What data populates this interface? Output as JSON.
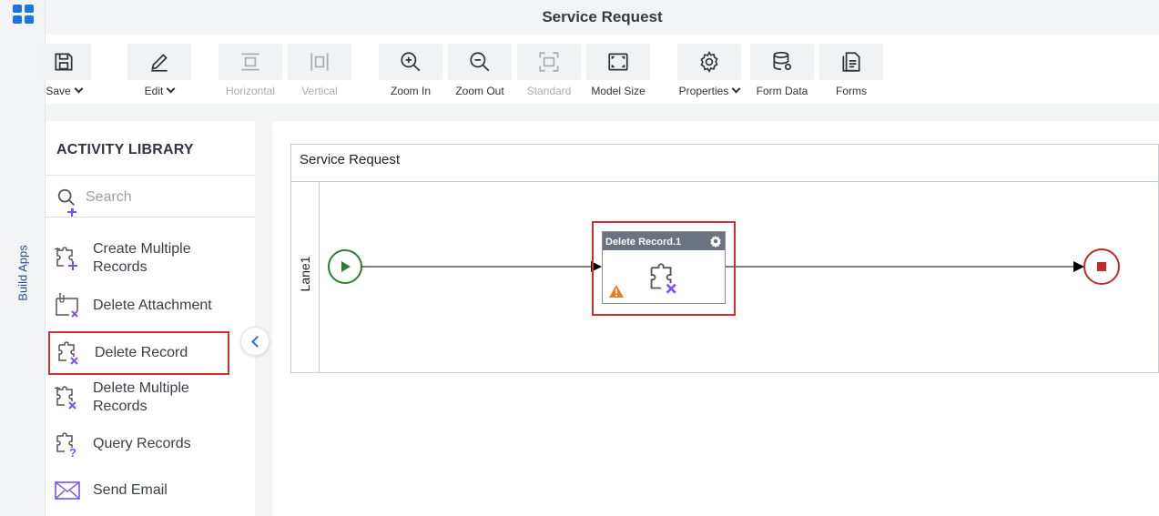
{
  "app": {
    "title": "Service Request",
    "rail_label": "Build Apps"
  },
  "toolbar": {
    "save": "Save",
    "edit": "Edit",
    "horizontal": "Horizontal",
    "vertical": "Vertical",
    "zoom_in": "Zoom In",
    "zoom_out": "Zoom Out",
    "standard": "Standard",
    "model_size": "Model Size",
    "properties": "Properties",
    "form_data": "Form Data",
    "forms": "Forms"
  },
  "library": {
    "title": "ACTIVITY LIBRARY",
    "search_placeholder": "Search",
    "items": [
      {
        "label": "Create Multiple Records",
        "line1": "Create Multiple",
        "line2": "Records",
        "icon": "puzzle-plus-icon"
      },
      {
        "label": "Delete Attachment",
        "icon": "attachment-delete-icon"
      },
      {
        "label": "Delete Record",
        "icon": "puzzle-delete-icon",
        "selected": true
      },
      {
        "label": "Delete Multiple Records",
        "line1": "Delete Multiple",
        "line2": "Records",
        "icon": "puzzle-multi-delete-icon"
      },
      {
        "label": "Query Records",
        "icon": "puzzle-query-icon"
      },
      {
        "label": "Send Email",
        "icon": "email-icon"
      }
    ]
  },
  "canvas": {
    "pool_name": "Service Request",
    "lane_name": "Lane1",
    "task_name": "Delete Record.1"
  },
  "colors": {
    "accent": "#1a73e8",
    "selection": "#d32f2f",
    "icon_purple": "#7c4dff",
    "start": "#2e7d32",
    "end": "#c62828",
    "warning": "#e67e22"
  }
}
